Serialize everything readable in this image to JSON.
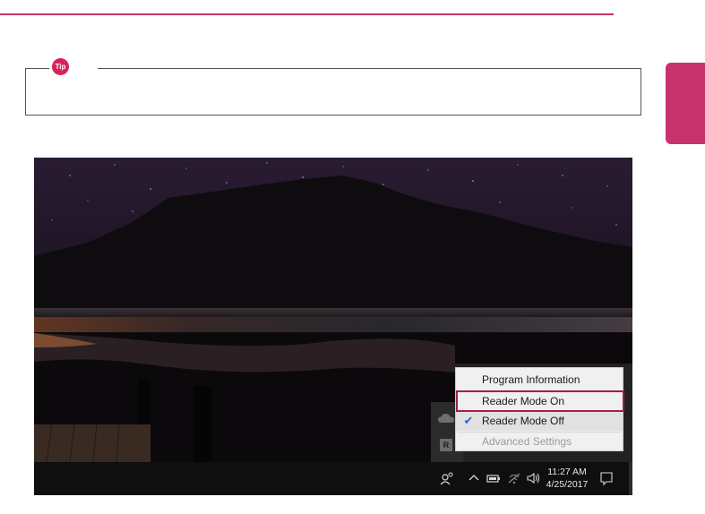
{
  "tip": {
    "badge_label": "Tip"
  },
  "screenshot": {
    "context_menu": {
      "items": [
        {
          "label": "Program Information",
          "checked": false,
          "disabled": false
        },
        {
          "label": "Reader Mode On",
          "checked": false,
          "disabled": false,
          "highlighted": true
        },
        {
          "label": "Reader Mode Off",
          "checked": true,
          "disabled": false
        },
        {
          "label": "Advanced Settings",
          "checked": false,
          "disabled": true
        }
      ]
    },
    "tray": {
      "reader_icon_label": "R"
    },
    "taskbar": {
      "time": "11:27 AM",
      "date": "4/25/2017",
      "icons": [
        "people-icon",
        "chevron-up-icon",
        "battery-icon",
        "wifi-icon",
        "volume-icon",
        "action-center-icon"
      ]
    }
  },
  "colors": {
    "accent": "#c8326a",
    "highlight": "#a3203f",
    "check": "#1e6fd0"
  }
}
